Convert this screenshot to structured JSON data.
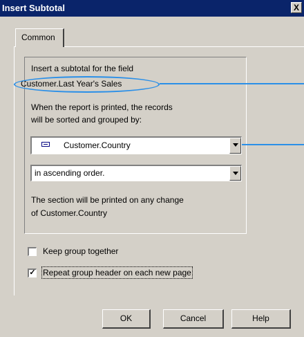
{
  "window": {
    "title": "Insert Subtotal",
    "close_glyph": "X"
  },
  "tabs": [
    {
      "label": "Common",
      "selected": true
    }
  ],
  "content": {
    "intro_line1": "Insert a subtotal for the field",
    "field_name": "Customer.Last Year's Sales",
    "sort_line1": "When the report is printed, the records",
    "sort_line2": "will be sorted and grouped by:",
    "group_by": {
      "value": "Customer.Country",
      "icon": "field-icon"
    },
    "order": {
      "value": "in ascending order."
    },
    "section_line1": "The section will be printed on any change",
    "section_line2": "of  Customer.Country"
  },
  "options": {
    "keep_group_together": {
      "label": "Keep group together",
      "checked": false
    },
    "repeat_header": {
      "label": "Repeat group header on each new page",
      "checked": true
    }
  },
  "buttons": {
    "ok": "OK",
    "cancel": "Cancel",
    "help": "Help"
  },
  "colors": {
    "titlebar": "#0a246a",
    "dialog": "#d4d0c8",
    "callout": "#2a8fe8"
  }
}
